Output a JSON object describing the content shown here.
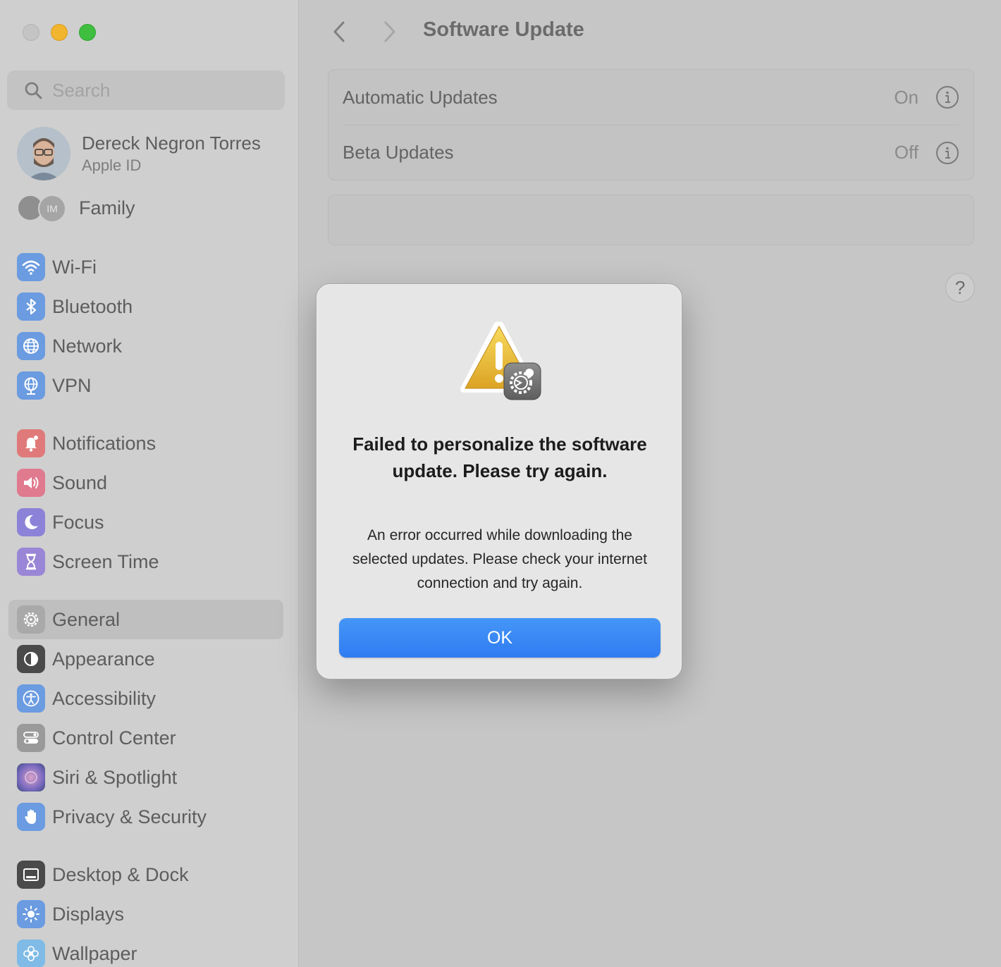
{
  "window": {
    "title": "Software Update"
  },
  "sidebar": {
    "search_placeholder": "Search",
    "profile": {
      "name": "Dereck Negron Torres",
      "subtitle": "Apple ID"
    },
    "family": {
      "label": "Family",
      "initials": "IM"
    },
    "items": [
      {
        "label": "Wi-Fi",
        "icon": "wifi-icon",
        "color": "#4d8fe6"
      },
      {
        "label": "Bluetooth",
        "icon": "bluetooth-icon",
        "color": "#4d8fe6"
      },
      {
        "label": "Network",
        "icon": "globe-icon",
        "color": "#4d8fe6"
      },
      {
        "label": "VPN",
        "icon": "vpn-globe-icon",
        "color": "#4d8fe6"
      },
      {
        "label": "Notifications",
        "icon": "bell-icon",
        "color": "#e26060"
      },
      {
        "label": "Sound",
        "icon": "speaker-icon",
        "color": "#e0607a"
      },
      {
        "label": "Focus",
        "icon": "moon-icon",
        "color": "#7b6fd6"
      },
      {
        "label": "Screen Time",
        "icon": "hourglass-icon",
        "color": "#8a6fd2"
      },
      {
        "label": "General",
        "icon": "gear-icon",
        "color": "#9a9a9a",
        "selected": true
      },
      {
        "label": "Appearance",
        "icon": "appearance-icon",
        "color": "#3a3a3a"
      },
      {
        "label": "Accessibility",
        "icon": "accessibility-icon",
        "color": "#4d8fe6"
      },
      {
        "label": "Control Center",
        "icon": "switches-icon",
        "color": "#8e8e8e"
      },
      {
        "label": "Siri & Spotlight",
        "icon": "siri-icon",
        "color": "#6a5fb8"
      },
      {
        "label": "Privacy & Security",
        "icon": "hand-icon",
        "color": "#4d8fe6"
      },
      {
        "label": "Desktop & Dock",
        "icon": "dock-icon",
        "color": "#3a3a3a"
      },
      {
        "label": "Displays",
        "icon": "sun-icon",
        "color": "#4d8fe6"
      },
      {
        "label": "Wallpaper",
        "icon": "flower-icon",
        "color": "#6fb7e8"
      }
    ]
  },
  "main": {
    "rows": [
      {
        "label": "Automatic Updates",
        "value": "On"
      },
      {
        "label": "Beta Updates",
        "value": "Off"
      }
    ],
    "help_label": "?"
  },
  "dialog": {
    "title": "Failed to personalize the software update. Please try again.",
    "message": "An error occurred while downloading the selected updates. Please check your internet connection and try again.",
    "ok_label": "OK",
    "accent": "#2f7cf2"
  }
}
